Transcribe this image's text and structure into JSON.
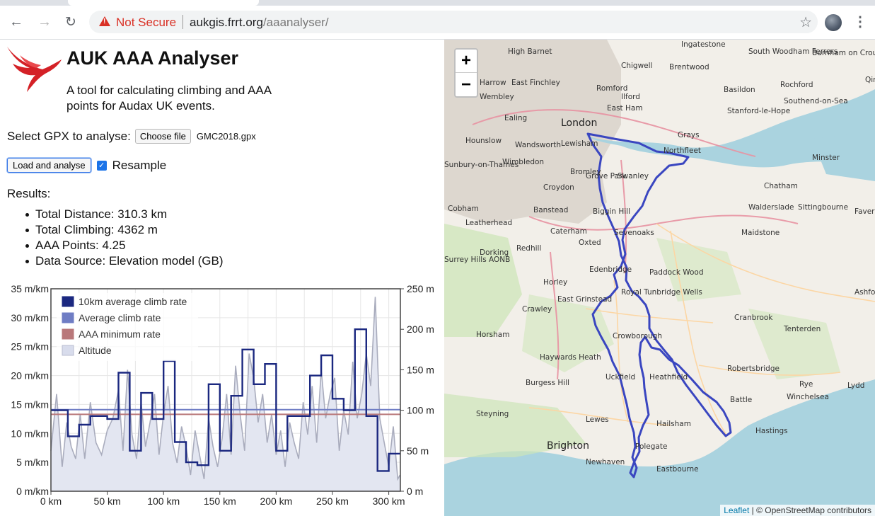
{
  "browser": {
    "security_label": "Not Secure",
    "url_host": "aukgis.frrt.org",
    "url_path": "/aaanalyser/"
  },
  "app": {
    "title": "AUK AAA Analyser",
    "description": "A tool for calculating climbing and AAA points for Audax UK events.",
    "select_label": "Select GPX to analyse:",
    "choose_file_label": "Choose file",
    "file_name": "GMC2018.gpx",
    "load_button": "Load and analyse",
    "resample_label": "Resample",
    "resample_checked": true,
    "results_heading": "Results:",
    "results": [
      "Total Distance: 310.3 km",
      "Total Climbing: 4362 m",
      "AAA Points: 4.25",
      "Data Source: Elevation model (GB)"
    ]
  },
  "chart_data": {
    "type": "line",
    "left_axis_ticks": [
      "0 m/km",
      "5 m/km",
      "10 m/km",
      "15 m/km",
      "20 m/km",
      "25 m/km",
      "30 m/km",
      "35 m/km"
    ],
    "right_axis_ticks": [
      "0 m",
      "50 m",
      "100 m",
      "150 m",
      "200 m",
      "250 m"
    ],
    "x_ticks": [
      "0 km",
      "50 km",
      "100 km",
      "150 km",
      "200 km",
      "250 km",
      "300 km"
    ],
    "xlim": [
      0,
      310.3
    ],
    "ylim_left": [
      0,
      35
    ],
    "ylim_right": [
      0,
      250
    ],
    "legend": [
      {
        "name": "10km average climb rate",
        "color": "#1b2880"
      },
      {
        "name": "Average climb rate",
        "color": "#6f7dc4"
      },
      {
        "name": "AAA minimum rate",
        "color": "#b9787a"
      },
      {
        "name": "Altitude",
        "color": "#d8dcec"
      }
    ],
    "series": [
      {
        "name": "10km average climb rate",
        "x": [
          0,
          15,
          25,
          35,
          50,
          60,
          70,
          80,
          90,
          100,
          110,
          120,
          130,
          140,
          150,
          160,
          170,
          180,
          190,
          200,
          210,
          220,
          230,
          240,
          250,
          260,
          270,
          280,
          290,
          300,
          310
        ],
        "y": [
          14,
          9.5,
          11.5,
          13,
          12.5,
          20.5,
          7,
          17,
          12.5,
          22.5,
          8.5,
          5,
          4.5,
          18.5,
          7,
          16.5,
          24.5,
          18.5,
          22,
          7,
          13,
          13,
          20,
          23.5,
          16,
          14,
          28,
          13,
          3.5,
          6.5,
          6.5
        ]
      },
      {
        "name": "Average climb rate",
        "x": [
          0,
          310.3
        ],
        "y": [
          14.1,
          14.1
        ]
      },
      {
        "name": "AAA minimum rate",
        "x": [
          0,
          310.3
        ],
        "y": [
          13.3,
          13.3
        ]
      },
      {
        "name": "Altitude",
        "x": [
          0,
          5,
          10,
          14,
          18,
          22,
          26,
          30,
          35,
          40,
          45,
          50,
          55,
          60,
          64,
          68,
          72,
          76,
          80,
          84,
          88,
          92,
          96,
          100,
          104,
          108,
          112,
          116,
          120,
          124,
          128,
          132,
          136,
          140,
          144,
          148,
          152,
          156,
          160,
          164,
          168,
          172,
          176,
          180,
          184,
          188,
          192,
          196,
          200,
          204,
          208,
          212,
          216,
          220,
          224,
          228,
          232,
          236,
          240,
          244,
          248,
          252,
          256,
          260,
          264,
          268,
          272,
          276,
          280,
          284,
          288,
          292,
          296,
          300,
          304,
          308,
          310
        ],
        "y": [
          50,
          120,
          30,
          85,
          55,
          40,
          95,
          40,
          110,
          60,
          45,
          75,
          90,
          125,
          50,
          150,
          70,
          40,
          110,
          55,
          85,
          120,
          45,
          95,
          130,
          60,
          35,
          80,
          55,
          20,
          75,
          45,
          15,
          90,
          55,
          30,
          65,
          120,
          45,
          155,
          95,
          50,
          170,
          140,
          85,
          120,
          60,
          95,
          45,
          75,
          30,
          85,
          60,
          40,
          110,
          70,
          130,
          60,
          150,
          90,
          120,
          140,
          50,
          100,
          70,
          160,
          90,
          120,
          170,
          130,
          240,
          90,
          60,
          30,
          80,
          15,
          20
        ]
      }
    ]
  },
  "map": {
    "zoom_in": "+",
    "zoom_out": "−",
    "attribution_link": "Leaflet",
    "attribution_text": " | © OpenStreetMap contributors",
    "places": [
      "Ingatestone",
      "South Woodham Ferrers",
      "Burnham on Crouch",
      "High Barnet",
      "Chigwell",
      "Brentwood",
      "Harrow",
      "East Finchley",
      "Romford",
      "Basildon",
      "Rochford",
      "Wembley",
      "Ilford",
      "Southend-on-Sea",
      "East Ham",
      "Ealing",
      "London",
      "Stanford-le-Hope",
      "Grays",
      "Hounslow",
      "Wandsworth",
      "Lewisham",
      "Northfleet",
      "Sunbury-on-Thames",
      "Wimbledon",
      "Grove Park",
      "Bromley",
      "Swanley",
      "Minster",
      "Croydon",
      "Chatham",
      "Cobham",
      "Banstead",
      "Biggin Hill",
      "Walderslade",
      "Sittingbourne",
      "Faversham",
      "Leatherhead",
      "Caterham",
      "Sevenoaks",
      "Maidstone",
      "Dorking",
      "Redhill",
      "Oxted",
      "Surrey Hills AONB",
      "Edenbridge",
      "Paddock Wood",
      "Horley",
      "Ashford",
      "Royal Tunbridge Wells",
      "East Grinstead",
      "Crawley",
      "Cranbrook",
      "Horsham",
      "Tenterden",
      "Crowborough",
      "Haywards Heath",
      "Robertsbridge",
      "Uckfield",
      "Heathfield",
      "Burgess Hill",
      "Rye",
      "Lydd",
      "Winchelsea",
      "Battle",
      "Steyning",
      "Lewes",
      "Hastings",
      "Hailsham",
      "Brighton",
      "Polegate",
      "Newhaven",
      "Eastbourne",
      "Qine (MoD Shoe"
    ]
  }
}
